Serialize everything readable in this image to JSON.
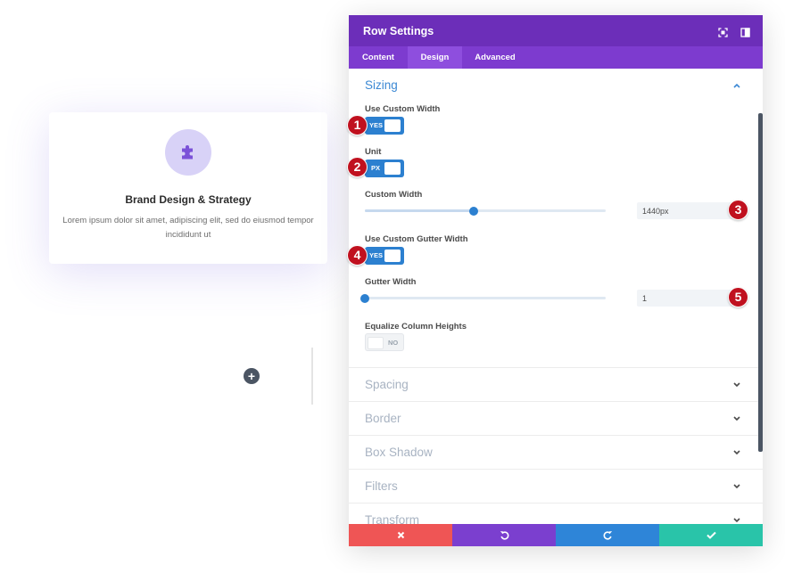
{
  "card": {
    "icon": "puzzle-piece-icon",
    "title": "Brand Design & Strategy",
    "body": "Lorem ipsum dolor sit amet, adipiscing elit, sed do eiusmod tempor incididunt ut"
  },
  "builder": {
    "add_icon": "+"
  },
  "panel": {
    "title": "Row Settings",
    "header_icons": [
      "fullscreen-icon",
      "split-view-icon"
    ],
    "tabs": [
      {
        "label": "Content",
        "active": false
      },
      {
        "label": "Design",
        "active": true
      },
      {
        "label": "Advanced",
        "active": false
      }
    ],
    "sizing": {
      "title": "Sizing",
      "use_custom_width": {
        "label": "Use Custom Width",
        "state": "YES"
      },
      "unit": {
        "label": "Unit",
        "state": "PX"
      },
      "custom_width": {
        "label": "Custom Width",
        "value": "1440px",
        "slider_fraction": 0.45
      },
      "use_custom_gutter": {
        "label": "Use Custom Gutter Width",
        "state": "YES"
      },
      "gutter_width": {
        "label": "Gutter Width",
        "value": "1",
        "slider_fraction": 0.0
      },
      "equalize": {
        "label": "Equalize Column Heights",
        "state": "NO"
      }
    },
    "collapsed_sections": [
      "Spacing",
      "Border",
      "Box Shadow",
      "Filters",
      "Transform"
    ],
    "footer": [
      {
        "action": "discard",
        "icon": "close-icon",
        "color": "#ef5555"
      },
      {
        "action": "undo",
        "icon": "undo-icon",
        "color": "#7b3fcf"
      },
      {
        "action": "redo",
        "icon": "redo-icon",
        "color": "#2e85d8"
      },
      {
        "action": "save",
        "icon": "check-icon",
        "color": "#29c4a9"
      }
    ]
  },
  "markers": [
    "1",
    "2",
    "3",
    "4",
    "5"
  ],
  "colors": {
    "header": "#6c2eb9",
    "tabs": "#7d3bcf",
    "accent_blue": "#2c80d0",
    "marker_red": "#c0111f"
  }
}
